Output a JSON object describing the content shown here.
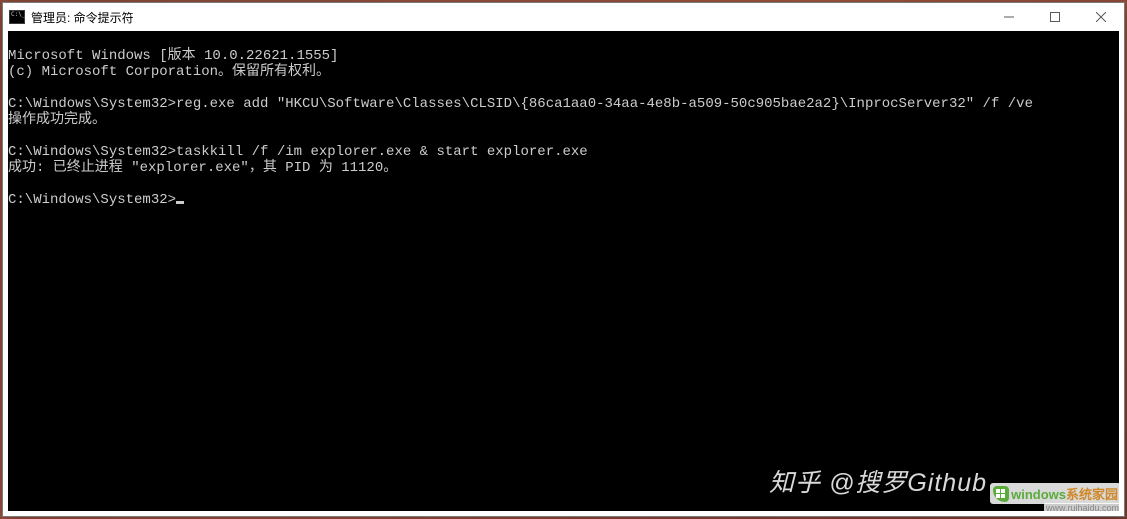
{
  "window": {
    "title": "管理员: 命令提示符"
  },
  "terminal": {
    "lines": [
      "Microsoft Windows [版本 10.0.22621.1555]",
      "(c) Microsoft Corporation。保留所有权利。",
      "",
      "C:\\Windows\\System32>reg.exe add \"HKCU\\Software\\Classes\\CLSID\\{86ca1aa0-34aa-4e8b-a509-50c905bae2a2}\\InprocServer32\" /f /ve",
      "操作成功完成。",
      "",
      "C:\\Windows\\System32>taskkill /f /im explorer.exe & start explorer.exe",
      "成功: 已终止进程 \"explorer.exe\"，其 PID 为 11120。",
      ""
    ],
    "prompt": "C:\\Windows\\System32>"
  },
  "watermark": {
    "zhihu": "知乎 @搜罗Github",
    "windows_text": "windows",
    "windows_suffix": "系统家园",
    "windows_url": "www.ruihaidu.com"
  }
}
